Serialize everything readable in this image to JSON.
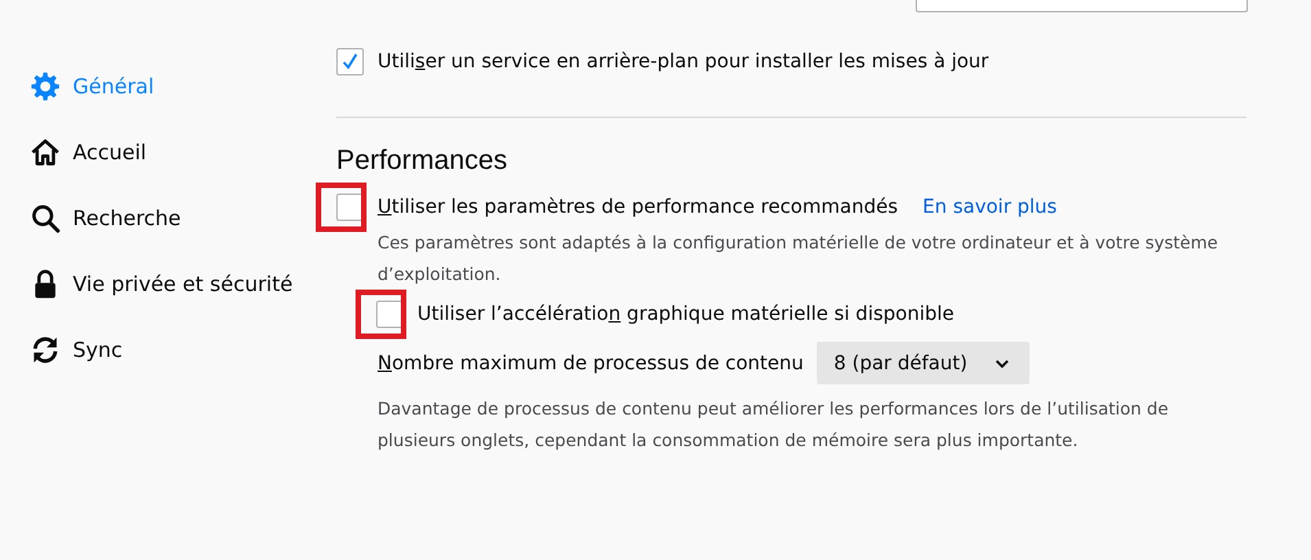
{
  "sidebar": {
    "items": [
      {
        "kind": "gear",
        "label": "Général",
        "selected": true
      },
      {
        "kind": "home",
        "label": "Accueil",
        "selected": false
      },
      {
        "kind": "search",
        "label": "Recherche",
        "selected": false
      },
      {
        "kind": "lock",
        "label": "Vie privée et sécurité",
        "selected": false
      },
      {
        "kind": "sync",
        "label": "Sync",
        "selected": false
      }
    ]
  },
  "updates": {
    "options": [
      {
        "label_parts": {
          "before": "Utili",
          "key": "s",
          "after": "er un service en arrière-plan pour installer les mises à jour"
        },
        "checked": true,
        "highlighted": false
      }
    ]
  },
  "performance": {
    "heading": "Performances",
    "recommended": {
      "label_parts": {
        "key": "U",
        "after": "tiliser les paramètres de performance recommandés"
      },
      "checked": false,
      "highlighted": true,
      "link": "En savoir plus",
      "description": "Ces paramètres sont adaptés à la configuration matérielle de votre ordinateur et à votre système d’exploitation."
    },
    "acceleration": {
      "label_parts": {
        "before": "Utiliser l’accélératio",
        "key": "n",
        "after": " graphique matérielle si disponible"
      },
      "checked": false,
      "highlighted": true
    },
    "process_limit": {
      "label_parts": {
        "key": "N",
        "after": "ombre maximum de processus de contenu"
      },
      "value": "8 (par défaut)",
      "description": "Davantage de processus de contenu peut améliorer les performances lors de l’utilisation de plusieurs onglets, cependant la consommation de mémoire sera plus importante."
    }
  }
}
